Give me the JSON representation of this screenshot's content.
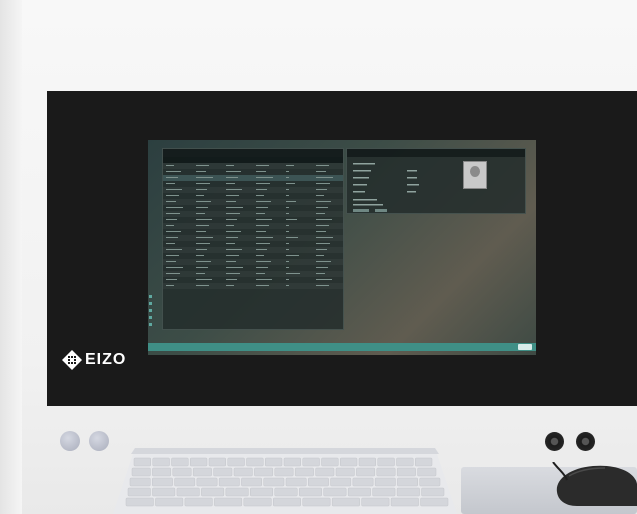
{
  "brand": {
    "logo_text": "EIZO"
  },
  "screen": {
    "taskbar_color": "#3f8f86",
    "left_window": {
      "columns": [
        "",
        "",
        "",
        "",
        "",
        ""
      ],
      "row_count": 21,
      "selected_row": 3
    },
    "right_window": {
      "has_portrait": true
    }
  },
  "hardware": {
    "buttons": [
      "button-1",
      "button-2"
    ],
    "ports": [
      "port-1",
      "port-2"
    ]
  },
  "colors": {
    "bezel": "#1a1a1a",
    "panel": "#f3f3f3",
    "taskbar": "#3f8f86"
  }
}
